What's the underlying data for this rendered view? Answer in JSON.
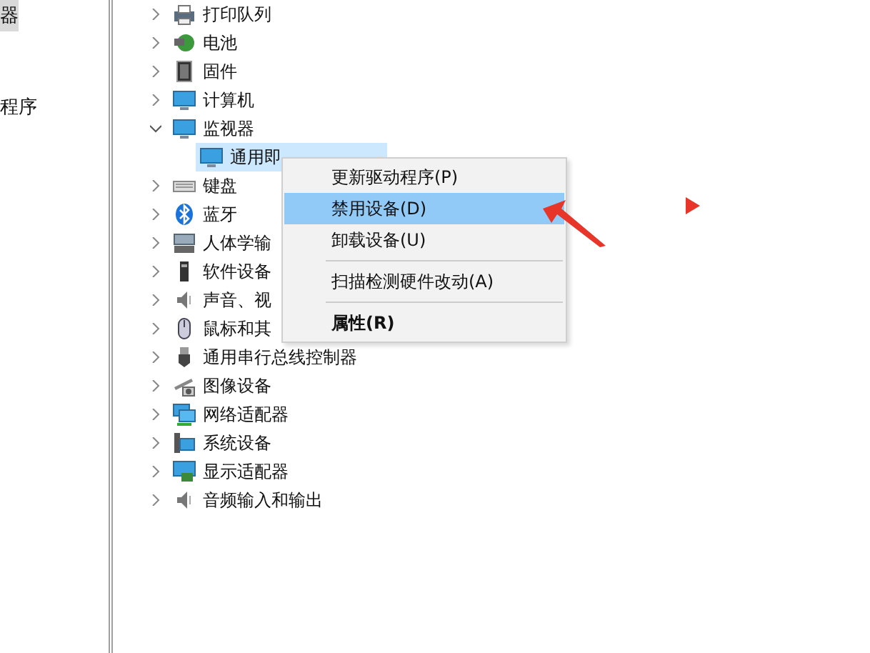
{
  "left_pane": {
    "items": [
      {
        "label": "器",
        "selected": true
      },
      {
        "label": "程序",
        "selected": false
      }
    ]
  },
  "tree": [
    {
      "label": "打印队列",
      "kind": "printer",
      "expanded": false
    },
    {
      "label": "电池",
      "kind": "battery",
      "expanded": false
    },
    {
      "label": "固件",
      "kind": "chip",
      "expanded": false
    },
    {
      "label": "计算机",
      "kind": "monitor",
      "expanded": false
    },
    {
      "label": "监视器",
      "kind": "monitor",
      "expanded": true,
      "children": [
        {
          "label": "通用即",
          "kind": "monitor",
          "selected": true
        }
      ]
    },
    {
      "label": "键盘",
      "kind": "keyboard",
      "expanded": false
    },
    {
      "label": "蓝牙",
      "kind": "bluetooth",
      "expanded": false
    },
    {
      "label": "人体学输",
      "kind": "hid",
      "expanded": false
    },
    {
      "label": "软件设备",
      "kind": "device",
      "expanded": false
    },
    {
      "label": "声音、视",
      "kind": "speaker",
      "expanded": false
    },
    {
      "label": "鼠标和其",
      "kind": "mouse",
      "expanded": false
    },
    {
      "label": "通用串行总线控制器",
      "kind": "usb",
      "expanded": false
    },
    {
      "label": "图像设备",
      "kind": "camera",
      "expanded": false
    },
    {
      "label": "网络适配器",
      "kind": "network",
      "expanded": false
    },
    {
      "label": "系统设备",
      "kind": "system",
      "expanded": false
    },
    {
      "label": "显示适配器",
      "kind": "display",
      "expanded": false
    },
    {
      "label": "音频输入和输出",
      "kind": "speaker",
      "expanded": false
    }
  ],
  "context_menu": {
    "items": [
      {
        "label": "更新驱动程序(P)",
        "kind": "item",
        "selected": false
      },
      {
        "label": "禁用设备(D)",
        "kind": "item",
        "selected": true
      },
      {
        "label": "卸载设备(U)",
        "kind": "item",
        "selected": false
      },
      {
        "kind": "separator"
      },
      {
        "label": "扫描检测硬件改动(A)",
        "kind": "item",
        "selected": false
      },
      {
        "kind": "separator"
      },
      {
        "label": "属性(R)",
        "kind": "default",
        "selected": false
      }
    ]
  }
}
